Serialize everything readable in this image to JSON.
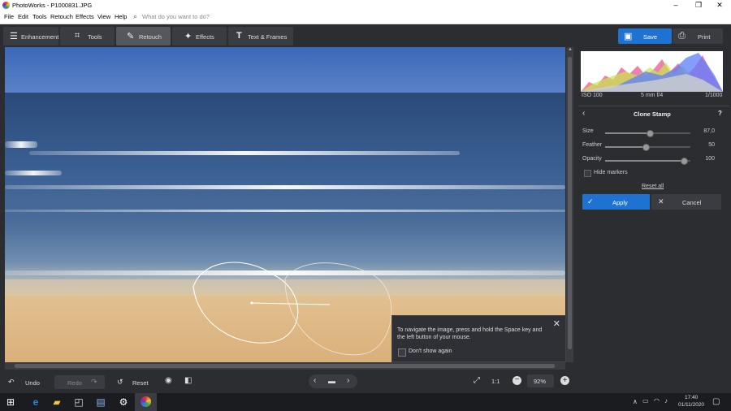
{
  "window": {
    "title": "PhotoWorks - P1000831.JPG",
    "minimize": "–",
    "maximize": "❐",
    "close": "✕"
  },
  "menu": {
    "items": [
      "File",
      "Edit",
      "Tools",
      "Retouch",
      "Effects",
      "View",
      "Help"
    ],
    "search_placeholder": "What do you want to do?"
  },
  "tabs": [
    {
      "label": "Enhancement",
      "icon": "sliders-icon"
    },
    {
      "label": "Tools",
      "icon": "crop-icon"
    },
    {
      "label": "Retouch",
      "icon": "brush-icon",
      "active": true
    },
    {
      "label": "Effects",
      "icon": "magic-wand-icon"
    },
    {
      "label": "Text & Frames",
      "icon": "text-icon"
    }
  ],
  "actions": {
    "save": "Save",
    "print": "Print"
  },
  "histogram": {
    "iso": "ISO 100",
    "lens": "5 mm f/4",
    "shutter": "1/1000"
  },
  "clone_stamp": {
    "title": "Clone Stamp",
    "help": "?",
    "size_label": "Size",
    "size_value": "87,0",
    "size_level": 0.52,
    "feather_label": "Feather",
    "feather_value": "50",
    "feather_level": 0.48,
    "opacity_label": "Opacity",
    "opacity_value": "100",
    "opacity_level": 0.92,
    "hide_markers": "Hide markers",
    "reset_all": "Reset all",
    "apply": "Apply",
    "cancel": "Cancel"
  },
  "tip": {
    "text": "To navigate the image, press and hold the Space key and the left button of your mouse.",
    "dont_show": "Don't show again"
  },
  "bottom": {
    "undo": "Undo",
    "redo": "Redo",
    "reset": "Reset",
    "one_to_one": "1:1",
    "zoom": "92%"
  },
  "taskbar": {
    "time": "17:40",
    "date": "01/11/2020"
  },
  "colors": {
    "accent": "#1e73d2",
    "panel": "#2b2d31",
    "button": "#3a3c41"
  }
}
